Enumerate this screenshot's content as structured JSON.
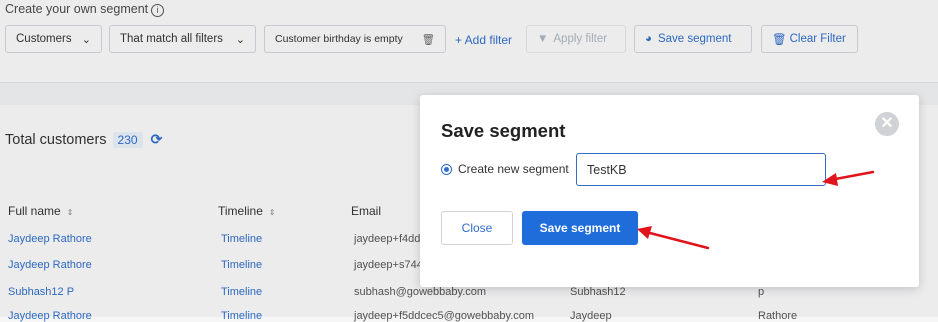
{
  "segment_builder": {
    "title": "Create your own segment",
    "info_icon": "info-icon",
    "filters": {
      "entity": "Customers",
      "match": "That match all filters",
      "condition": "Customer birthday is empty"
    },
    "actions": {
      "add_filter": "+ Add filter",
      "apply_filter": "Apply filter",
      "save_segment": "Save segment",
      "clear_filter": "Clear Filter"
    }
  },
  "summary": {
    "label": "Total customers",
    "count": "230"
  },
  "table": {
    "headers": [
      "Full name",
      "Timeline",
      "Email"
    ],
    "rows": [
      {
        "name": "Jaydeep Rathore",
        "timeline": "Timeline",
        "email": "jaydeep+f4dd",
        "c4": "",
        "c5": ""
      },
      {
        "name": "Jaydeep Rathore",
        "timeline": "Timeline",
        "email": "jaydeep+s744",
        "c4": "",
        "c5": ""
      },
      {
        "name": "Subhash12 P",
        "timeline": "Timeline",
        "email": "subhash@gowebbaby.com",
        "c4": "Subhash12",
        "c5": "p"
      },
      {
        "name": "Jaydeep Rathore",
        "timeline": "Timeline",
        "email": "jaydeep+f5ddcec5@gowebbaby.com",
        "c4": "Jaydeep",
        "c5": "Rathore"
      }
    ]
  },
  "modal": {
    "title": "Save segment",
    "option_label": "Create new segment",
    "segment_name_value": "TestKB",
    "close_label": "Close",
    "save_label": "Save segment"
  },
  "colors": {
    "accent": "#1f6ddb",
    "link": "#2f6dc7",
    "annotation": "#e0141a"
  }
}
